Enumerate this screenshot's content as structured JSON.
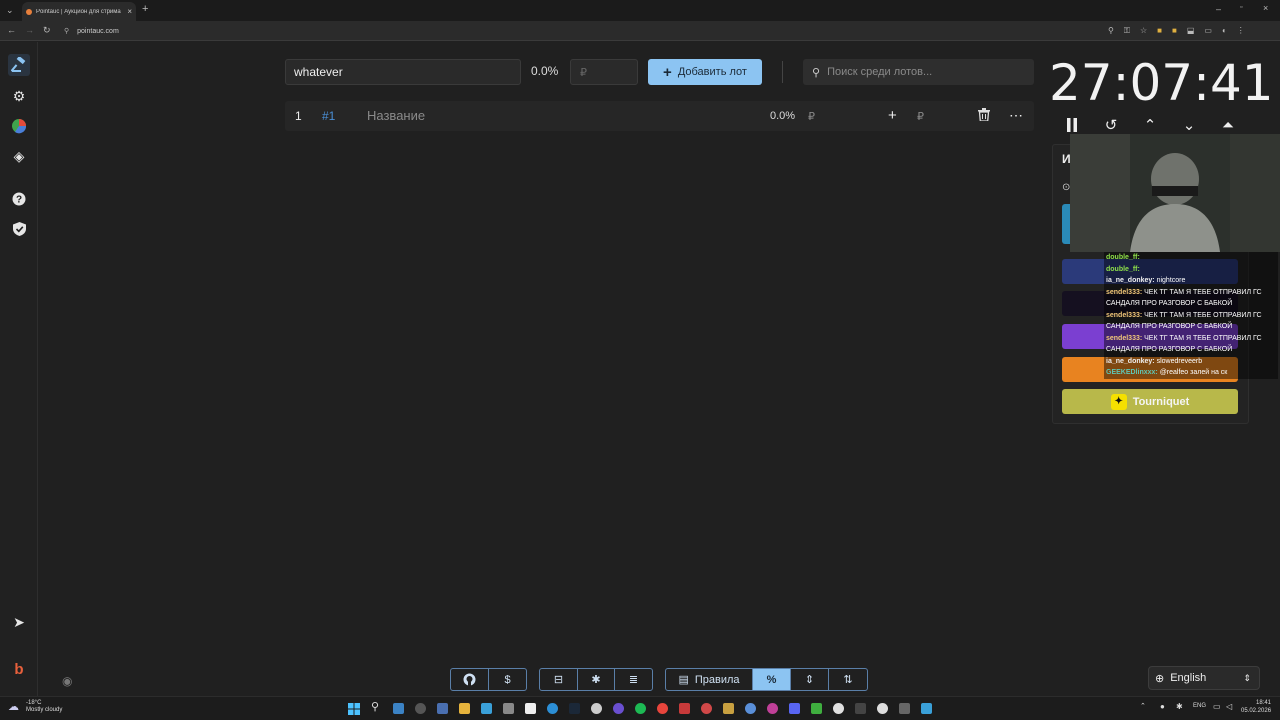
{
  "browser": {
    "tab_title": "Pointauc | Аукцион для стрима",
    "url": "pointauc.com"
  },
  "controls": {
    "lot_name_value": "whatever",
    "percent": "0.0%",
    "amount_placeholder": "₽",
    "add_button_label": "Добавить лот",
    "search_placeholder": "Поиск среди лотов..."
  },
  "lot_row": {
    "index": "1",
    "id_tag": "#1",
    "name_placeholder": "Название",
    "percent": "0.0%",
    "currency": "₽",
    "add_currency": "₽"
  },
  "timer": {
    "value": "27:07:41"
  },
  "panel": {
    "tourniquet_label": "Tourniquet"
  },
  "chat": [
    {
      "user": "double_ff:",
      "text": "",
      "color": "#8ee04a"
    },
    {
      "user": "double_ff:",
      "text": "",
      "color": "#8ee04a"
    },
    {
      "user": "ia_ne_donkey:",
      "text": "nightcore",
      "color": "#f0f0f0"
    },
    {
      "user": "sendel333:",
      "text": "ЧЕК ТГ ТАМ Я ТЕБЕ ОТПРАВИЛ ГС САНДАЛЯ ПРО РАЗГОВОР С БАБКОЙ",
      "color": "#f2c879"
    },
    {
      "user": "sendel333:",
      "text": "ЧЕК ТГ ТАМ Я ТЕБЕ ОТПРАВИЛ ГС САНДАЛЯ ПРО РАЗГОВОР С БАБКОЙ",
      "color": "#f2c879"
    },
    {
      "user": "sendel333:",
      "text": "ЧЕК ТГ ТАМ Я ТЕБЕ ОТПРАВИЛ ГС САНДАЛЯ ПРО РАЗГОВОР С БАБКОЙ",
      "color": "#f2c879"
    },
    {
      "user": "ia_ne_donkey:",
      "text": "slowedreveerb",
      "color": "#f0f0f0"
    },
    {
      "user": "GEEKEDlinxxx:",
      "text": "@realfeo залей на ск",
      "color": "#5fc6b5"
    }
  ],
  "bottom_toolbar": {
    "rules_label": "Правила"
  },
  "language": {
    "selected": "English"
  },
  "taskbar": {
    "weather_temp": "-18°C",
    "weather_desc": "Mostly cloudy",
    "lang": "ENG",
    "time": "18:41",
    "date": "05.02.2026"
  },
  "colors": {
    "accent": "#8cc4f2",
    "background": "#202020",
    "tourniquet": "#b8b84a"
  }
}
